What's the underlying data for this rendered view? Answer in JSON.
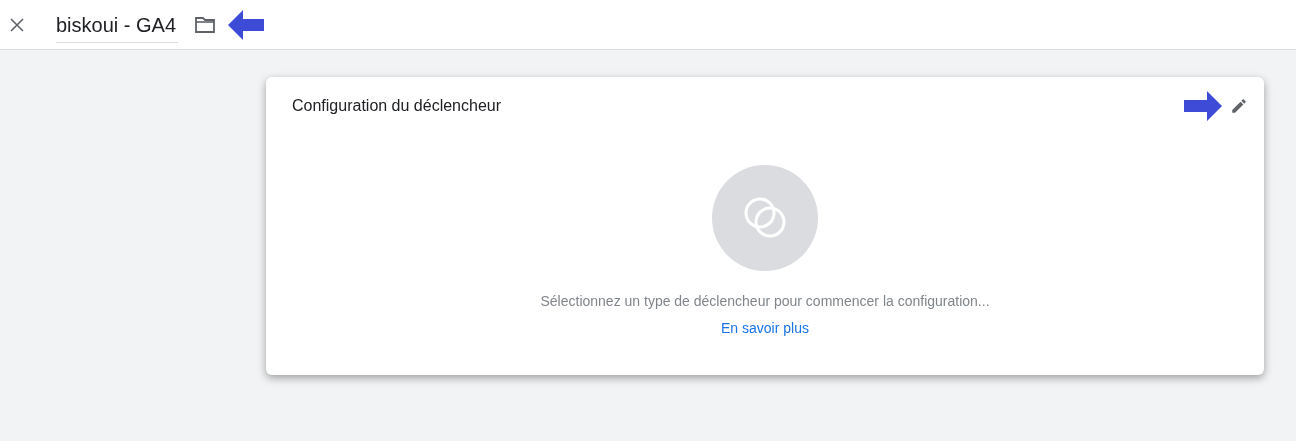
{
  "header": {
    "title": "biskoui - GA4"
  },
  "card": {
    "title": "Configuration du déclencheur",
    "message": "Sélectionnez un type de déclencheur pour commencer la configuration...",
    "link": "En savoir plus"
  }
}
